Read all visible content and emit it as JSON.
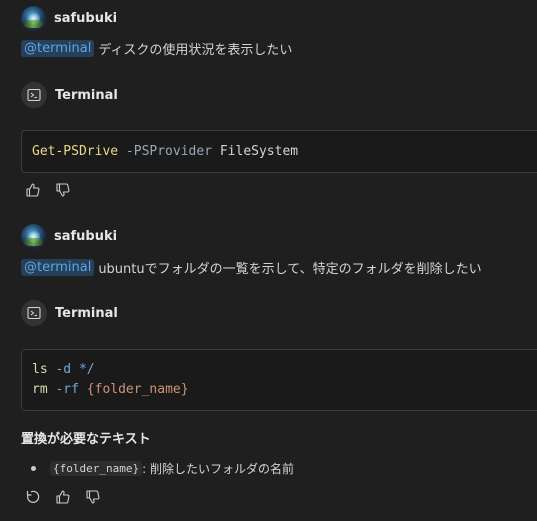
{
  "messages": [
    {
      "user": "safubuki",
      "mention": "@terminal",
      "text": "ディスクの使用状況を表示したい",
      "agent": "Terminal",
      "code_lines": [
        [
          {
            "t": "Get-PSDrive",
            "c": "tok-cmd"
          },
          {
            "t": " ",
            "c": "tok-text"
          },
          {
            "t": "-PSProvider",
            "c": "tok-param"
          },
          {
            "t": " FileSystem",
            "c": "tok-text"
          }
        ]
      ]
    },
    {
      "user": "safubuki",
      "mention": "@terminal",
      "text": "ubuntuでフォルダの一覧を示して、特定のフォルダを削除したい",
      "agent": "Terminal",
      "code_lines": [
        [
          {
            "t": "ls",
            "c": "tok-cmd2"
          },
          {
            "t": " ",
            "c": "tok-text"
          },
          {
            "t": "-d",
            "c": "tok-flag"
          },
          {
            "t": " ",
            "c": "tok-text"
          },
          {
            "t": "*/",
            "c": "tok-arg"
          }
        ],
        [
          {
            "t": "rm",
            "c": "tok-cmd2"
          },
          {
            "t": " ",
            "c": "tok-text"
          },
          {
            "t": "-rf",
            "c": "tok-flag"
          },
          {
            "t": " ",
            "c": "tok-text"
          },
          {
            "t": "{folder_name}",
            "c": "tok-placeholder"
          }
        ]
      ]
    }
  ],
  "replace_section": {
    "title": "置換が必要なテキスト",
    "items": [
      {
        "code": "{folder_name}",
        "desc": ": 削除したいフォルダの名前"
      }
    ]
  },
  "icons": {
    "agent": "terminal-icon",
    "like": "thumbs-up-icon",
    "dislike": "thumbs-down-icon",
    "retry": "retry-icon"
  }
}
